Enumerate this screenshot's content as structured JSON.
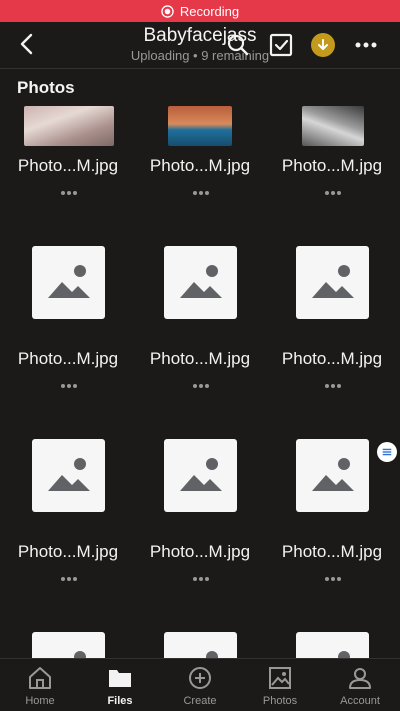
{
  "status_bar": {
    "recording_label": "Recording",
    "color": "#e5394a"
  },
  "header": {
    "title": "Babyfacejass",
    "subtitle": "Uploading • 9 remaining"
  },
  "section": {
    "title": "Photos"
  },
  "files": [
    {
      "name": "Photo...M.jpg",
      "thumb": "photo"
    },
    {
      "name": "Photo...M.jpg",
      "thumb": "photo"
    },
    {
      "name": "Photo...M.jpg",
      "thumb": "photo"
    },
    {
      "name": "Photo...M.jpg",
      "thumb": "placeholder"
    },
    {
      "name": "Photo...M.jpg",
      "thumb": "placeholder"
    },
    {
      "name": "Photo...M.jpg",
      "thumb": "placeholder"
    },
    {
      "name": "Photo...M.jpg",
      "thumb": "placeholder"
    },
    {
      "name": "Photo...M.jpg",
      "thumb": "placeholder"
    },
    {
      "name": "Photo...M.jpg",
      "thumb": "placeholder"
    },
    {
      "name": "",
      "thumb": "placeholder"
    },
    {
      "name": "",
      "thumb": "placeholder"
    },
    {
      "name": "",
      "thumb": "placeholder"
    }
  ],
  "tabs": [
    {
      "label": "Home",
      "icon": "home-icon",
      "active": false
    },
    {
      "label": "Files",
      "icon": "folder-icon",
      "active": true
    },
    {
      "label": "Create",
      "icon": "plus-circle-icon",
      "active": false
    },
    {
      "label": "Photos",
      "icon": "image-icon",
      "active": false
    },
    {
      "label": "Account",
      "icon": "person-icon",
      "active": false
    }
  ],
  "colors": {
    "background": "#1b1a19",
    "accent_gold": "#c49a1c",
    "muted_text": "#9a9896"
  }
}
